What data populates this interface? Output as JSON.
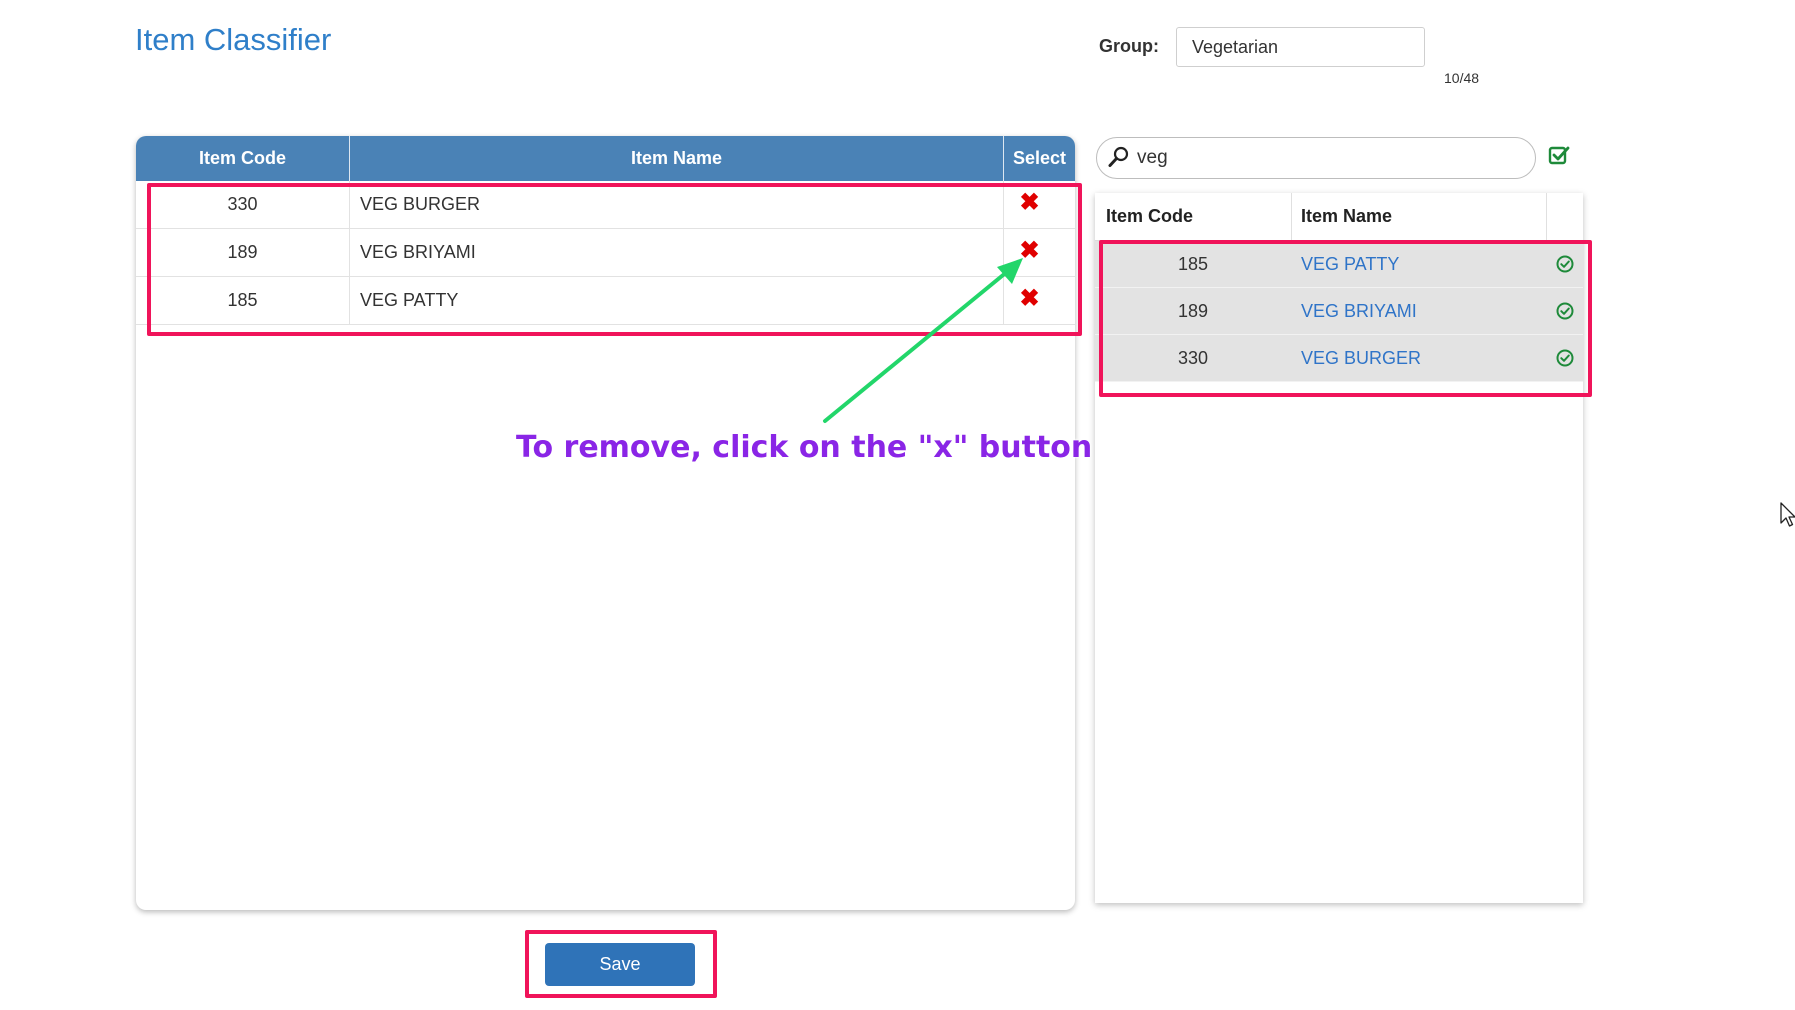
{
  "header": {
    "title": "Item Classifier",
    "group_label": "Group:",
    "group_value": "Vegetarian",
    "counter": "10/48"
  },
  "selected_table": {
    "columns": [
      "Item Code",
      "Item Name",
      "Select"
    ],
    "rows": [
      {
        "code": "330",
        "name": "VEG BURGER",
        "action": "✖"
      },
      {
        "code": "189",
        "name": "VEG BRIYAMI",
        "action": "✖"
      },
      {
        "code": "185",
        "name": "VEG PATTY",
        "action": "✖"
      }
    ]
  },
  "search": {
    "value": "veg",
    "icon": "search-icon",
    "select_all_icon": "check-square-icon"
  },
  "results_table": {
    "columns": [
      "Item Code",
      "Item Name"
    ],
    "rows": [
      {
        "code": "185",
        "name": "VEG PATTY",
        "icon": "check-circle-icon"
      },
      {
        "code": "189",
        "name": "VEG BRIYAMI",
        "icon": "check-circle-icon"
      },
      {
        "code": "330",
        "name": "VEG BURGER",
        "icon": "check-circle-icon"
      }
    ]
  },
  "footer": {
    "save_label": "Save"
  },
  "annotation": {
    "text": "To remove, click on the \"x\" button"
  },
  "colors": {
    "title": "#2f7fc9",
    "table_header": "#4a82b6",
    "remove": "#e00000",
    "link": "#2f74c8",
    "confirm": "#1e8a3a",
    "highlight": "#f0145a",
    "annotation_text": "#8a25e6",
    "annotation_arrow": "#22d66a",
    "save_button": "#2f73b8"
  }
}
